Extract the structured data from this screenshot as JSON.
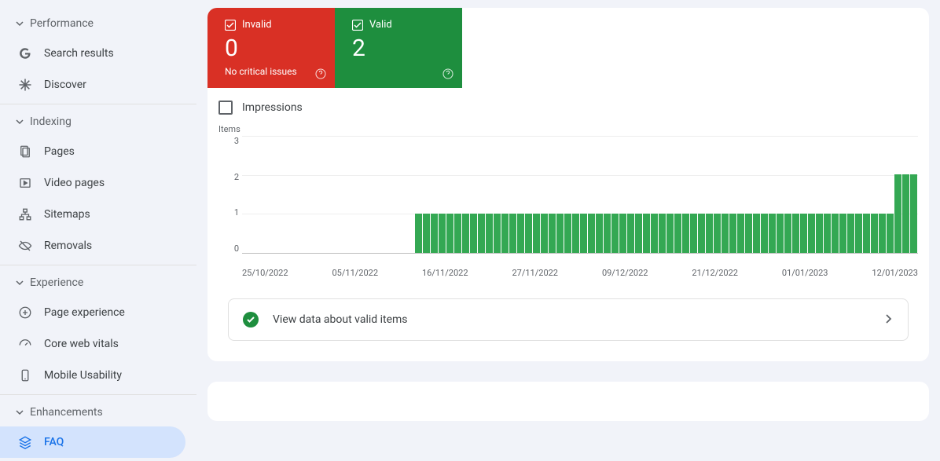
{
  "sidebar": {
    "sections": [
      {
        "header": "Performance",
        "items": [
          "Search results",
          "Discover"
        ]
      },
      {
        "header": "Indexing",
        "items": [
          "Pages",
          "Video pages",
          "Sitemaps",
          "Removals"
        ]
      },
      {
        "header": "Experience",
        "items": [
          "Page experience",
          "Core web vitals",
          "Mobile Usability"
        ]
      },
      {
        "header": "Enhancements",
        "items": [
          "FAQ"
        ]
      }
    ]
  },
  "stats": {
    "invalid": {
      "label": "Invalid",
      "value": "0",
      "sub": "No critical issues"
    },
    "valid": {
      "label": "Valid",
      "value": "2",
      "sub": ""
    }
  },
  "impressions_label": "Impressions",
  "chart": {
    "ylabel": "Items",
    "yticks": [
      "3",
      "2",
      "1",
      "0"
    ],
    "xticks": [
      "25/10/2022",
      "05/11/2022",
      "16/11/2022",
      "27/11/2022",
      "09/12/2022",
      "21/12/2022",
      "01/01/2023",
      "12/01/2023"
    ]
  },
  "view_data_label": "View data about valid items",
  "chart_data": {
    "type": "bar",
    "ylabel": "Items",
    "ylim": [
      0,
      3
    ],
    "x_start": "25/10/2022",
    "x_end_approx": "18/01/2023",
    "categories_ticks": [
      "25/10/2022",
      "05/11/2022",
      "16/11/2022",
      "27/11/2022",
      "09/12/2022",
      "21/12/2022",
      "01/01/2023",
      "12/01/2023"
    ],
    "series": [
      {
        "name": "Valid",
        "color": "#34a853",
        "values": [
          0,
          0,
          0,
          0,
          0,
          0,
          0,
          0,
          0,
          0,
          0,
          0,
          0,
          0,
          0,
          0,
          0,
          0,
          0,
          0,
          0,
          0,
          1,
          1,
          1,
          1,
          1,
          1,
          1,
          1,
          1,
          1,
          1,
          1,
          1,
          1,
          1,
          1,
          1,
          1,
          1,
          1,
          1,
          1,
          1,
          1,
          1,
          1,
          1,
          1,
          1,
          1,
          1,
          1,
          1,
          1,
          1,
          1,
          1,
          1,
          1,
          1,
          1,
          1,
          1,
          1,
          1,
          1,
          1,
          1,
          1,
          1,
          1,
          1,
          1,
          1,
          1,
          1,
          1,
          1,
          1,
          1,
          1,
          2,
          2,
          2
        ]
      }
    ]
  }
}
